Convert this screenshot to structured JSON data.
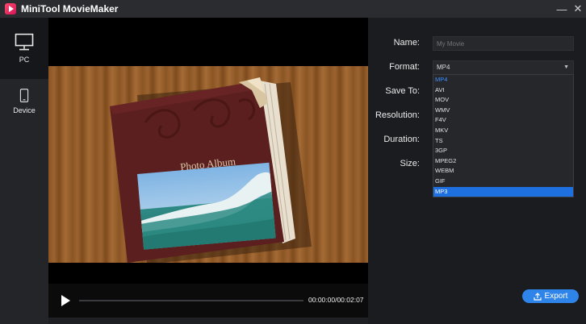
{
  "app": {
    "title": "MiniTool MovieMaker"
  },
  "window": {
    "minimize_glyph": "—",
    "close_glyph": "✕"
  },
  "sidebar": {
    "items": [
      {
        "label": "PC",
        "icon": "monitor-icon",
        "active": true
      },
      {
        "label": "Device",
        "icon": "phone-icon",
        "active": false
      }
    ]
  },
  "preview": {
    "album_title": "Photo Album",
    "time": "00:00:00/00:02:07"
  },
  "settings": {
    "name_label": "Name:",
    "name_placeholder": "My Movie",
    "format_label": "Format:",
    "format_value": "MP4",
    "save_to_label": "Save To:",
    "resolution_label": "Resolution:",
    "duration_label": "Duration:",
    "size_label": "Size:",
    "format_options": [
      "MP4",
      "AVI",
      "MOV",
      "WMV",
      "F4V",
      "MKV",
      "TS",
      "3GP",
      "MPEG2",
      "WEBM",
      "GIF",
      "MP3"
    ],
    "hovered_option": "MP3"
  },
  "export": {
    "label": "Export"
  },
  "colors": {
    "accent": "#2f84ea",
    "selected_option_text": "#3f8fff",
    "hover_option_bg": "#1e6fe0"
  }
}
